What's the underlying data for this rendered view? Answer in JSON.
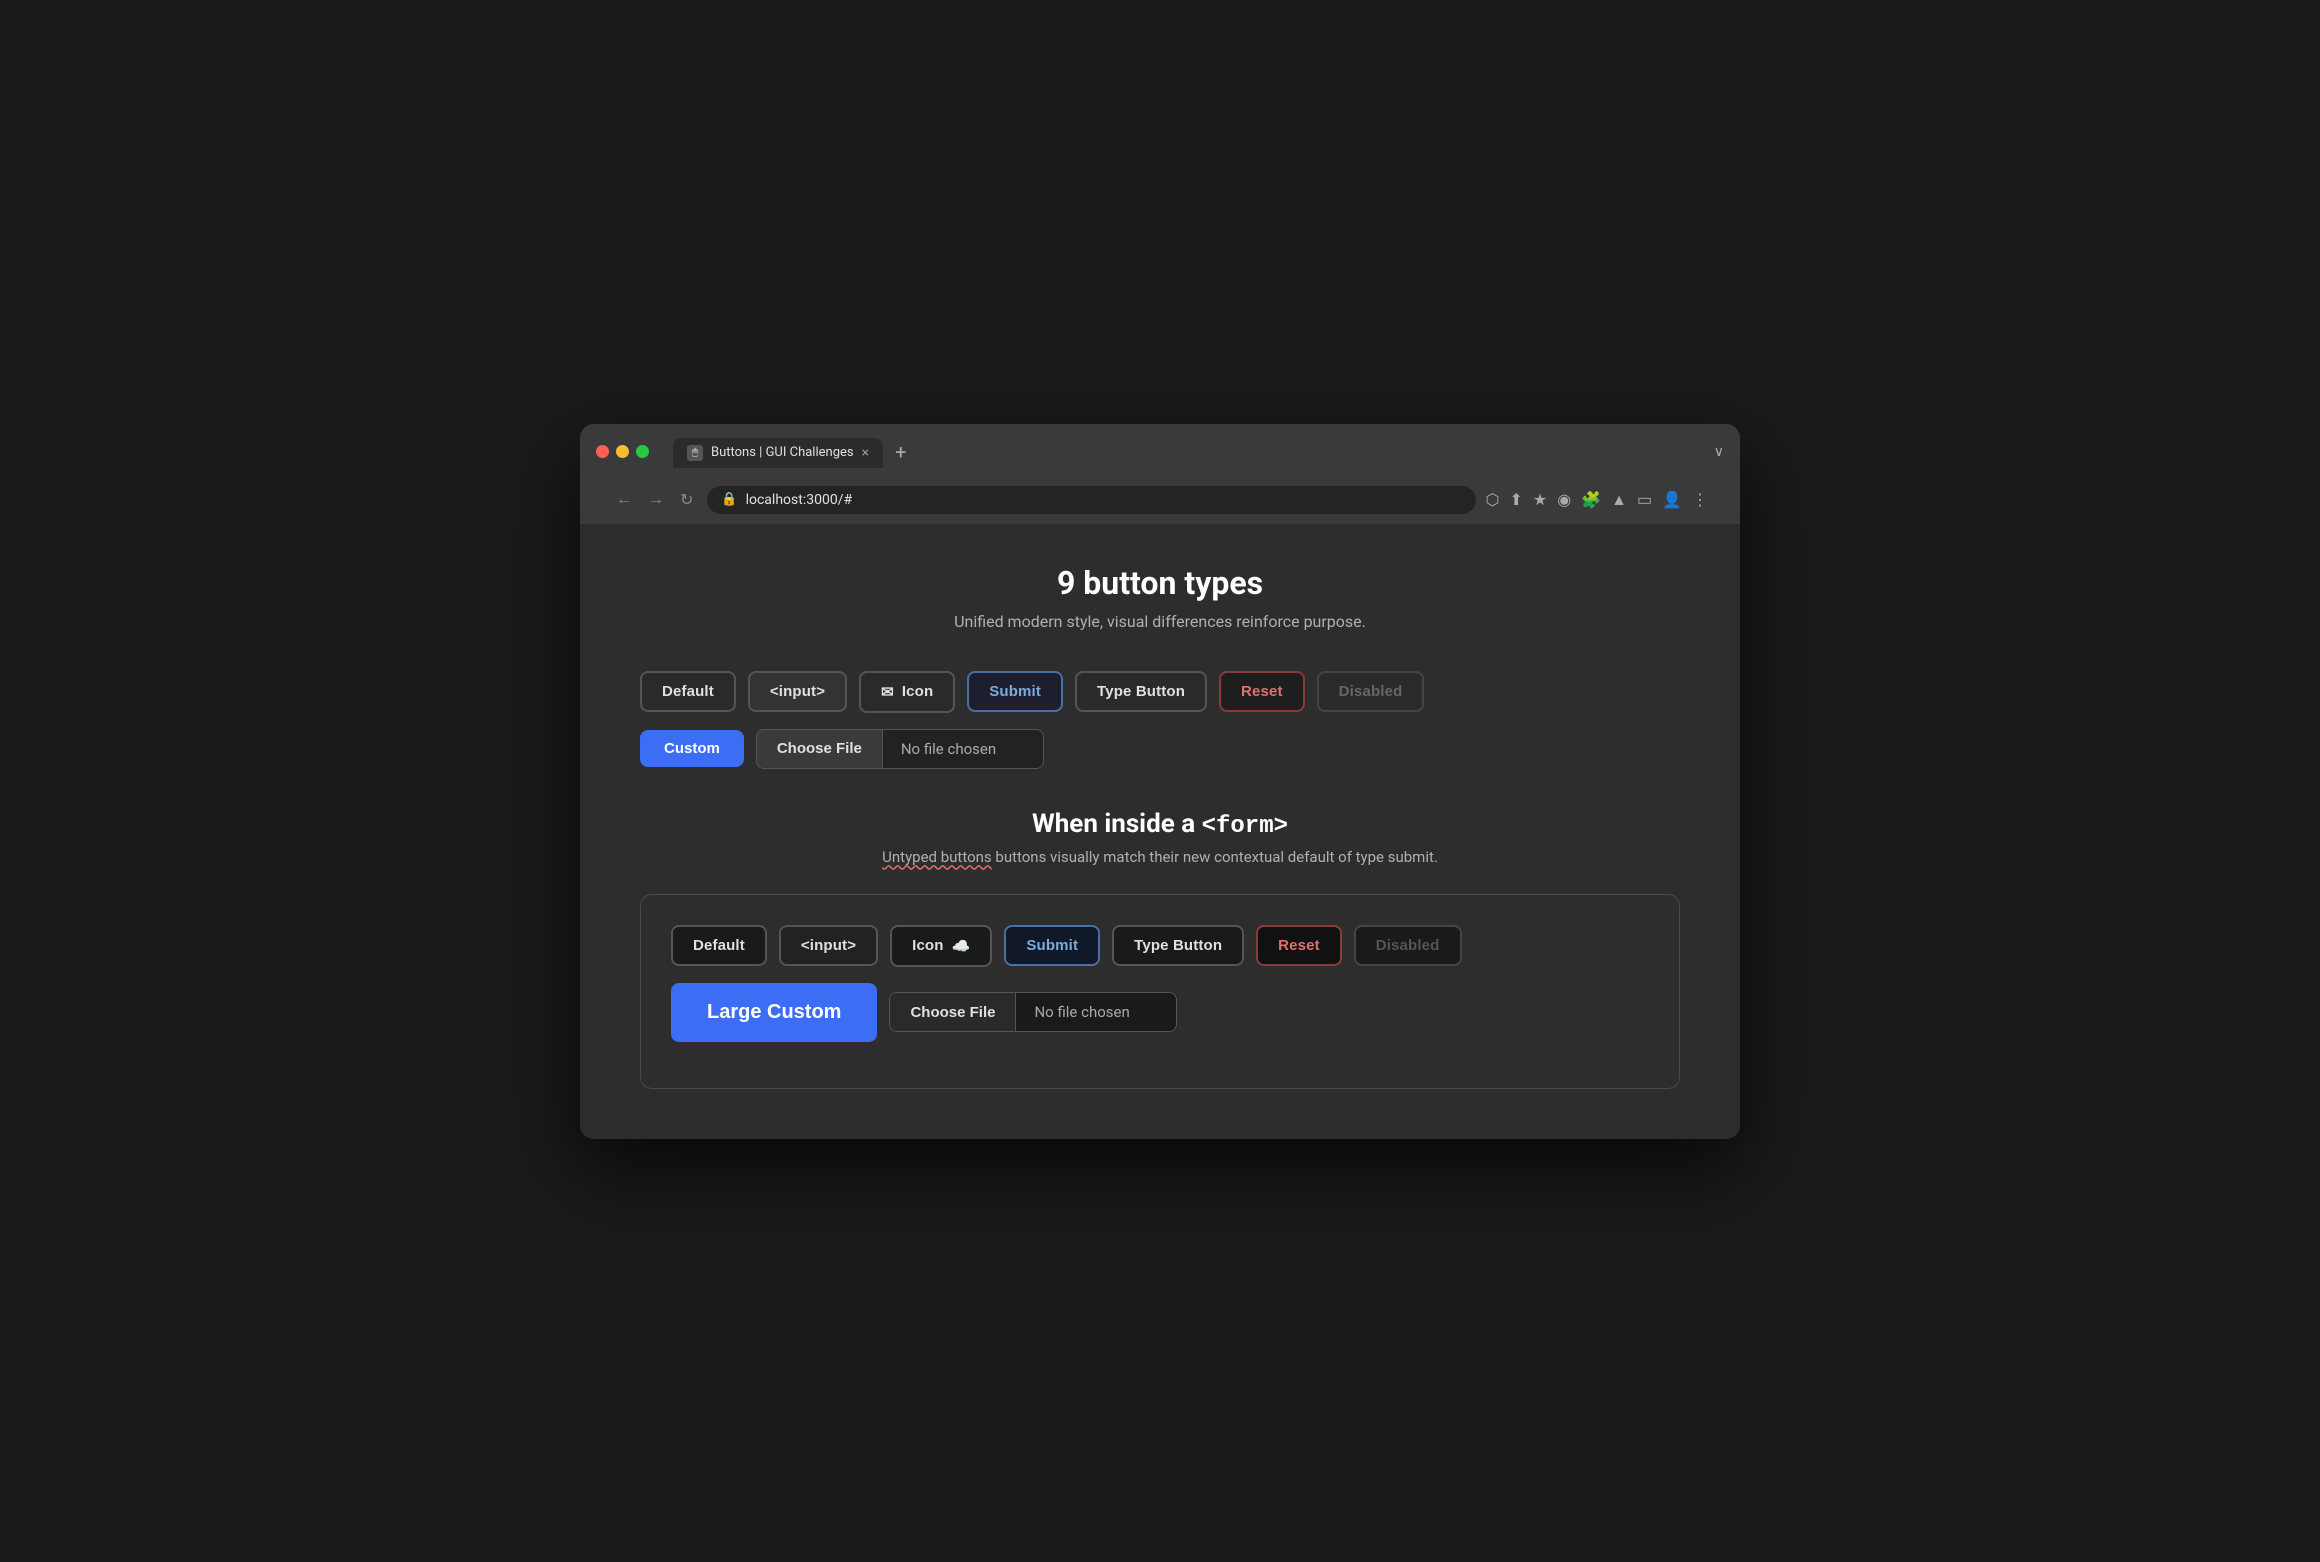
{
  "browser": {
    "tab_title": "Buttons | GUI Challenges",
    "tab_close": "×",
    "tab_new": "+",
    "tab_end": "∨",
    "address": "localhost:3000/#",
    "nav_back": "←",
    "nav_forward": "→",
    "nav_refresh": "↻"
  },
  "page": {
    "title": "9 button types",
    "subtitle": "Unified modern style, visual differences reinforce purpose.",
    "form_section_title_pre": "When inside a ",
    "form_section_title_code": "<form>",
    "form_section_subtitle_normal": " buttons visually match their new contextual default of type submit.",
    "form_section_subtitle_underlined": "Untyped buttons"
  },
  "top_buttons": {
    "default_label": "Default",
    "input_label": "<input>",
    "icon_label": "Icon",
    "submit_label": "Submit",
    "type_button_label": "Type Button",
    "reset_label": "Reset",
    "disabled_label": "Disabled",
    "custom_label": "Custom",
    "file_choose_label": "Choose File",
    "file_no_chosen_label": "No file chosen"
  },
  "form_buttons": {
    "default_label": "Default",
    "input_label": "<input>",
    "icon_label": "Icon",
    "icon_emoji": "☁️",
    "submit_label": "Submit",
    "type_button_label": "Type Button",
    "reset_label": "Reset",
    "disabled_label": "Disabled",
    "custom_label": "Large Custom",
    "file_choose_label": "Choose File",
    "file_no_chosen_label": "No file chosen"
  }
}
